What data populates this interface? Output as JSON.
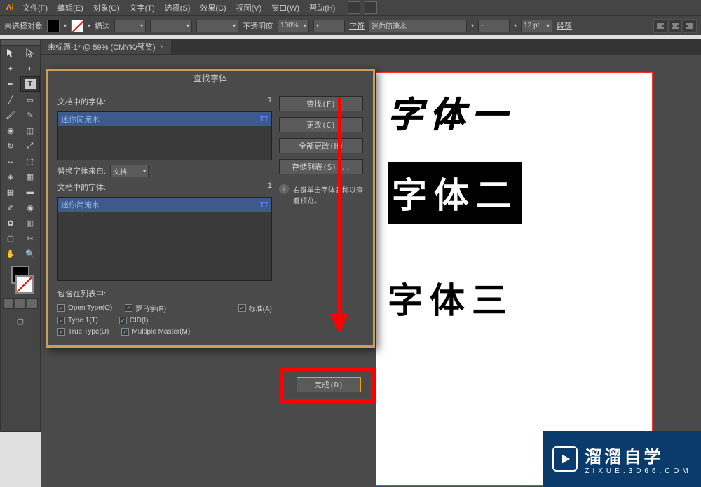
{
  "menubar": {
    "logo": "Ai",
    "items": [
      "文件(F)",
      "编辑(E)",
      "对象(O)",
      "文字(T)",
      "选择(S)",
      "效果(C)",
      "视图(V)",
      "窗口(W)",
      "帮助(H)"
    ]
  },
  "optionsbar": {
    "noselection": "未选择对象",
    "stroke_label": "描边",
    "opacity_label": "不透明度",
    "opacity_value": "100%",
    "char_label": "字符",
    "font_value": "迷你简淹水",
    "size_value": "12 pt",
    "paragraph_label": "段落"
  },
  "document": {
    "tab_title": "未标题-1* @ 59% (CMYK/预览)"
  },
  "canvas": {
    "text1": "字体一",
    "text2": "字体二",
    "text3": "字体三"
  },
  "dialog": {
    "title": "查找字体",
    "doc_fonts_label": "文档中的字体:",
    "doc_fonts_count": "1",
    "font_item": "迷你简淹水",
    "replace_from_label": "替换字体来自:",
    "replace_from_value": "文档",
    "doc_fonts_label2": "文档中的字体:",
    "doc_fonts_count2": "1",
    "include_label": "包含在列表中:",
    "chk_opentype": "Open Type(O)",
    "chk_roman": "罗马字(R)",
    "chk_standard": "标准(A)",
    "chk_type1": "Type 1(T)",
    "chk_cid": "CID(I)",
    "chk_truetype": "True Type(U)",
    "chk_mm": "Multiple Master(M)",
    "btn_find": "查找(F)",
    "btn_change": "更改(C)",
    "btn_change_all": "全部更改(H)",
    "btn_save_list": "存储列表(S)...",
    "btn_done": "完成(D)",
    "hint": "右键单击字体名称以查看预览。"
  },
  "watermark": {
    "main": "溜溜自学",
    "sub": "ZIXUE.3D66.COM"
  }
}
